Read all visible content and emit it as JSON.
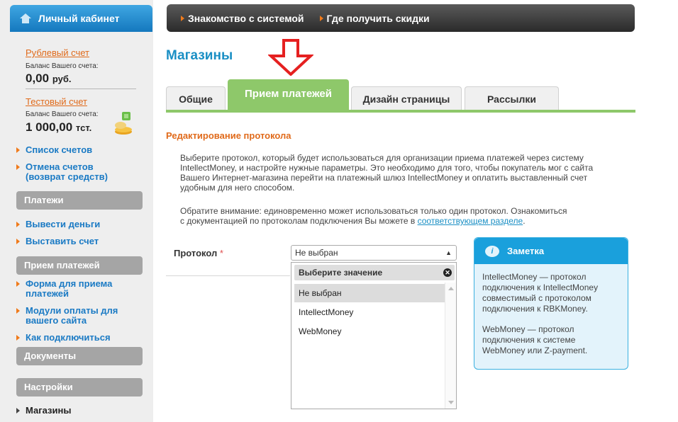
{
  "sidebar": {
    "cabinet_title": "Личный кабинет",
    "rub_account": {
      "link": "Рублевый счет",
      "caption": "Баланс Вашего счета:",
      "value": "0,00",
      "unit": "руб."
    },
    "test_account": {
      "link": "Тестовый счет",
      "caption": "Баланс Вашего счета:",
      "value": "1 000,00",
      "unit": "тст."
    },
    "accounts_links": [
      "Список счетов",
      "Отмена счетов",
      "(возврат средств)"
    ],
    "payments_head": "Платежи",
    "payments_links": [
      "Вывести деньги",
      "Выставить счет"
    ],
    "receive_head": "Прием платежей",
    "receive_links": [
      "Форма для приема",
      "платежей",
      "Модули оплаты для",
      "вашего сайта",
      "Как подключиться"
    ],
    "documents_head": "Документы",
    "settings_head": "Настройки",
    "settings_links": [
      "Магазины"
    ]
  },
  "topbar": {
    "items": [
      "Знакомство с системой",
      "Где получить скидки"
    ]
  },
  "page_title": "Магазины",
  "tabs": [
    "Общие",
    "Прием платежей",
    "Дизайн страницы",
    "Рассылки"
  ],
  "section_title": "Редактирование протокола",
  "description": [
    "Выберите протокол, который будет использоваться для организации приема платежей через систему",
    "IntellectMoney, и настройте нужные параметры. Это необходимо для того, чтобы покупатель мог с сайта",
    "Вашего Интернет-магазина перейти на платежный шлюз IntellectMoney и оплатить выставленный счет",
    "удобным для него способом."
  ],
  "notice": {
    "line1": "Обратите внимание: единовременно может использоваться только один протокол. Ознакомиться",
    "line2": "с документацией по протоколам подключения Вы можете в ",
    "link": "соответствующем разделе",
    "tail": "."
  },
  "form": {
    "protocol_label": "Протокол",
    "required_mark": "*",
    "selected": "Не выбран",
    "dropdown_header": "Выберите значение",
    "options": [
      "Не выбран",
      "IntellectMoney",
      "WebMoney"
    ]
  },
  "note": {
    "title": "Заметка",
    "icon_glyph": "i",
    "p1": [
      "IntellectMoney — протокол",
      "подключения к IntellectMoney",
      "совместимый с протоколом",
      "подключения к RBKMoney."
    ],
    "p2": [
      "WebMoney — протокол",
      "подключения к системе",
      "WebMoney или Z-payment."
    ]
  },
  "colors": {
    "accent_blue": "#1a8fc4",
    "tab_green": "#8ec86a",
    "link_orange": "#e06a1a",
    "annotation_red": "#e52020"
  }
}
